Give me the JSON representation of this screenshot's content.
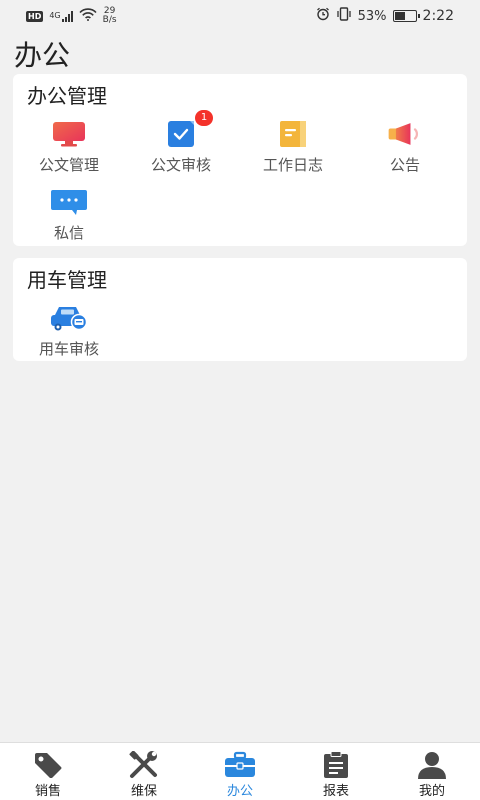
{
  "status_bar": {
    "hd": "HD",
    "network": "4G",
    "speed_value": "29",
    "speed_unit": "B/s",
    "battery": "53%",
    "time": "2:22"
  },
  "page": {
    "title": "办公"
  },
  "office_section": {
    "title": "办公管理",
    "items": [
      {
        "label": "公文管理",
        "icon": "monitor-icon",
        "color": "#ee4a4a"
      },
      {
        "label": "公文审核",
        "icon": "check-doc-icon",
        "color": "#2a7fe0",
        "badge": "1"
      },
      {
        "label": "工作日志",
        "icon": "notebook-icon",
        "color": "#f3b53b"
      },
      {
        "label": "公告",
        "icon": "megaphone-icon",
        "color": "#ef4f4f"
      },
      {
        "label": "私信",
        "icon": "chat-bubble-icon",
        "color": "#2f8ee8"
      }
    ]
  },
  "vehicle_section": {
    "title": "用车管理",
    "items": [
      {
        "label": "用车审核",
        "icon": "car-check-icon",
        "color": "#2a7fe0"
      }
    ]
  },
  "tab_bar": {
    "items": [
      {
        "label": "销售",
        "icon": "tag-icon"
      },
      {
        "label": "维保",
        "icon": "tools-icon"
      },
      {
        "label": "办公",
        "icon": "briefcase-icon",
        "active": true
      },
      {
        "label": "报表",
        "icon": "clipboard-icon"
      },
      {
        "label": "我的",
        "icon": "person-icon"
      }
    ],
    "active_color": "#2a87dd",
    "inactive_color": "#4a4a4a"
  }
}
